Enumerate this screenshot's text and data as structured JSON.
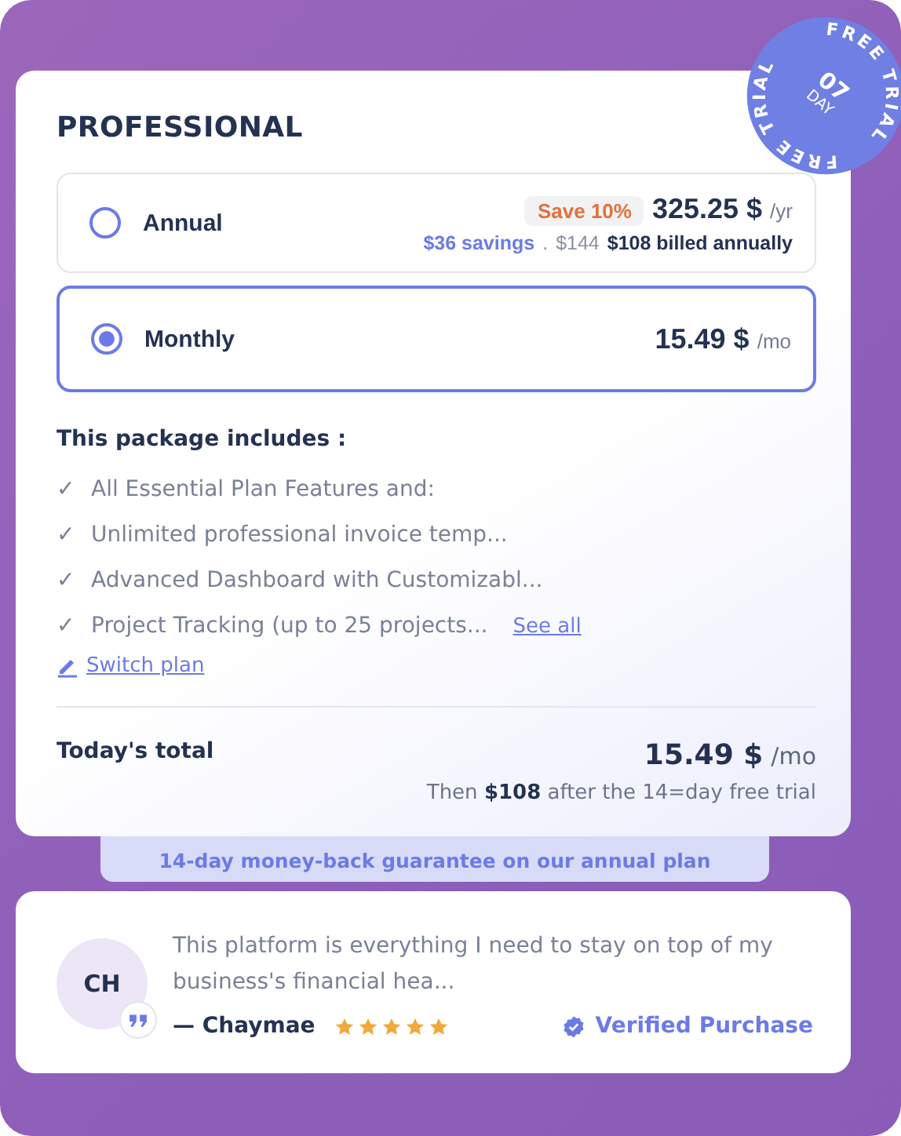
{
  "badge": {
    "ring_text": [
      "FREE TRIAL",
      "FREE TRIAL"
    ],
    "number": "07",
    "unit": "DAY"
  },
  "plan": {
    "title": "PROFESSIONAL",
    "options": [
      {
        "kind": "annual",
        "label": "Annual",
        "selected": false,
        "tag": "Save 10%",
        "price": "325.25 $",
        "unit": "/yr",
        "savings": "$36 savings",
        "separator": ".",
        "old_price": "$144",
        "billed": "$108 billed annually"
      },
      {
        "kind": "monthly",
        "label": "Monthly",
        "selected": true,
        "price": "15.49 $",
        "unit": "/mo"
      }
    ]
  },
  "includes": {
    "heading": "This package includes :",
    "check": "✓",
    "features": [
      "All Essential Plan Features and:",
      "Unlimited professional invoice temp...",
      "Advanced Dashboard with Customizabl...",
      "Project Tracking (up to 25 projects..."
    ],
    "see_all": "See all",
    "switch_plan": "Switch plan"
  },
  "total": {
    "label": "Today's total",
    "price": "15.49 $",
    "unit": "/mo",
    "note": "Then **$108** after the 14=day free trial"
  },
  "guarantee": "14-day money-back guarantee on our annual plan",
  "review": {
    "initials": "CH",
    "quote": "This platform is everything I need to stay on top of my business's financial hea...",
    "author": "— Chaymae",
    "stars": 5,
    "verified": "Verified Purchase"
  }
}
